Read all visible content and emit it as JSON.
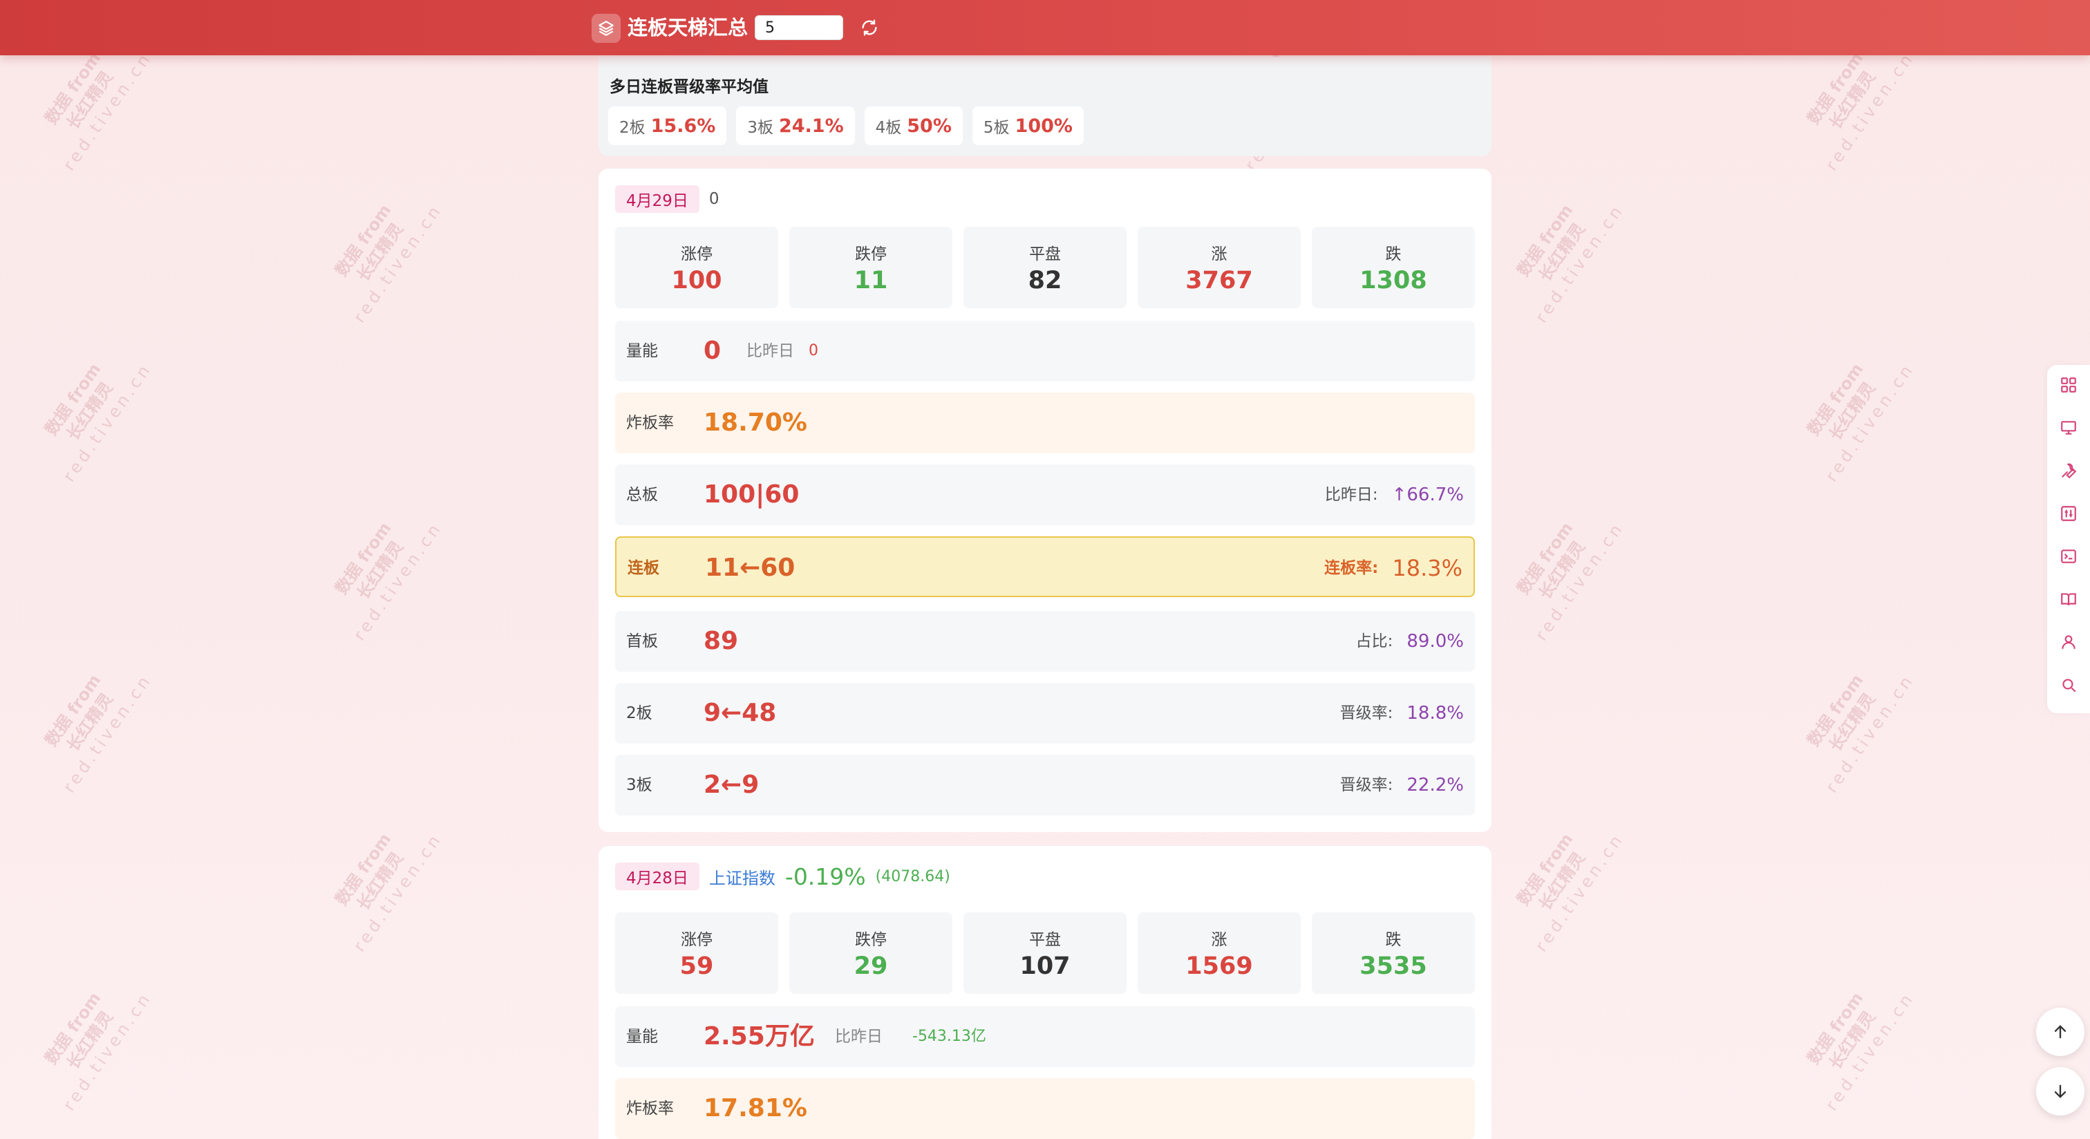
{
  "header": {
    "title": "连板天梯汇总",
    "days_value": "5",
    "logo_icon": "layers-icon",
    "refresh_icon": "refresh-icon"
  },
  "watermark": {
    "line1": "数据 from",
    "line2": "长红精灵",
    "line3": "red.tiven.cn"
  },
  "average": {
    "title": "多日连板晋级率平均值",
    "items": [
      {
        "label": "2板",
        "value": "15.6%"
      },
      {
        "label": "3板",
        "value": "24.1%"
      },
      {
        "label": "4板",
        "value": "50%"
      },
      {
        "label": "5板",
        "value": "100%"
      }
    ]
  },
  "days": [
    {
      "date": "4月29日",
      "extra": "0",
      "stats": [
        {
          "label": "涨停",
          "value": "100"
        },
        {
          "label": "跌停",
          "value": "11"
        },
        {
          "label": "平盘",
          "value": "82"
        },
        {
          "label": "涨",
          "value": "3767"
        },
        {
          "label": "跌",
          "value": "1308"
        }
      ],
      "energy": {
        "label": "量能",
        "value": "0",
        "compare_label": "比昨日",
        "compare_value": "0"
      },
      "break_rate": {
        "label": "炸板率",
        "value": "18.70%"
      },
      "total": {
        "label": "总板",
        "value": "100|60",
        "right_label": "比昨日:",
        "right_value": "↑66.7%"
      },
      "consecutive": {
        "label": "连板",
        "value": "11←60",
        "right_label": "连板率:",
        "right_value": "18.3%"
      },
      "first": {
        "label": "首板",
        "value": "89",
        "right_label": "占比:",
        "right_value": "89.0%"
      },
      "board2": {
        "label": "2板",
        "value": "9←48",
        "right_label": "晋级率:",
        "right_value": "18.8%"
      },
      "board3": {
        "label": "3板",
        "value": "2←9",
        "right_label": "晋级率:",
        "right_value": "22.2%"
      }
    },
    {
      "date": "4月28日",
      "index_name": "上证指数",
      "index_change": "-0.19%",
      "index_level": "(4078.64)",
      "stats": [
        {
          "label": "涨停",
          "value": "59"
        },
        {
          "label": "跌停",
          "value": "29"
        },
        {
          "label": "平盘",
          "value": "107"
        },
        {
          "label": "涨",
          "value": "1569"
        },
        {
          "label": "跌",
          "value": "3535"
        }
      ],
      "energy": {
        "label": "量能",
        "value": "2.55万亿",
        "compare_label": "比昨日",
        "compare_value": "-543.13亿"
      },
      "break_rate": {
        "label": "炸板率",
        "value": "17.81%"
      }
    }
  ],
  "toolbar": {
    "icons": [
      "grid-icon",
      "monitor-icon",
      "wrench-icon",
      "sliders-icon",
      "terminal-icon",
      "book-icon",
      "user-icon",
      "search-icon"
    ]
  },
  "scroll": {
    "up_icon": "arrow-up-icon",
    "down_icon": "arrow-down-icon"
  }
}
